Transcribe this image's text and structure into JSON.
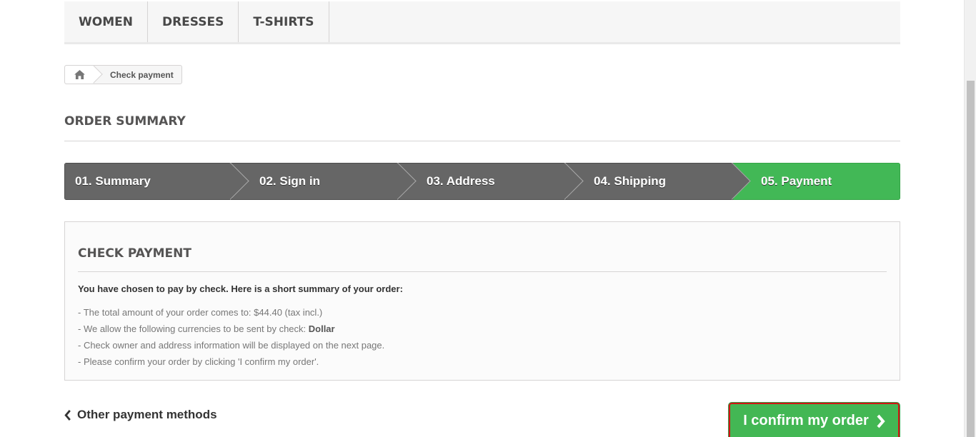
{
  "menu": {
    "items": [
      {
        "label": "WOMEN"
      },
      {
        "label": "DRESSES"
      },
      {
        "label": "T-SHIRTS"
      }
    ]
  },
  "breadcrumb": {
    "home_icon": "home-icon",
    "current": "Check payment"
  },
  "page_heading": "ORDER SUMMARY",
  "steps": [
    {
      "label": "01. Summary",
      "state": "done"
    },
    {
      "label": "02. Sign in",
      "state": "done"
    },
    {
      "label": "03. Address",
      "state": "done"
    },
    {
      "label": "04. Shipping",
      "state": "done"
    },
    {
      "label": "05. Payment",
      "state": "current"
    }
  ],
  "payment_box": {
    "title": "CHECK PAYMENT",
    "intro": "You have chosen to pay by check. Here is a short summary of your order:",
    "line1": "- The total amount of your order comes to: $44.40 (tax incl.)",
    "line2_prefix": "- We allow the following currencies to be sent by check: ",
    "line2_currency": "Dollar",
    "line3": "- Check owner and address information will be displayed on the next page.",
    "line4": "- Please confirm your order by clicking 'I confirm my order'."
  },
  "actions": {
    "other_methods_label": "Other payment methods",
    "confirm_label": "I confirm my order"
  },
  "colors": {
    "step_active": "#42b856",
    "step_inactive": "#666666",
    "confirm_button": "#43b754",
    "confirm_outline": "#d31313"
  }
}
